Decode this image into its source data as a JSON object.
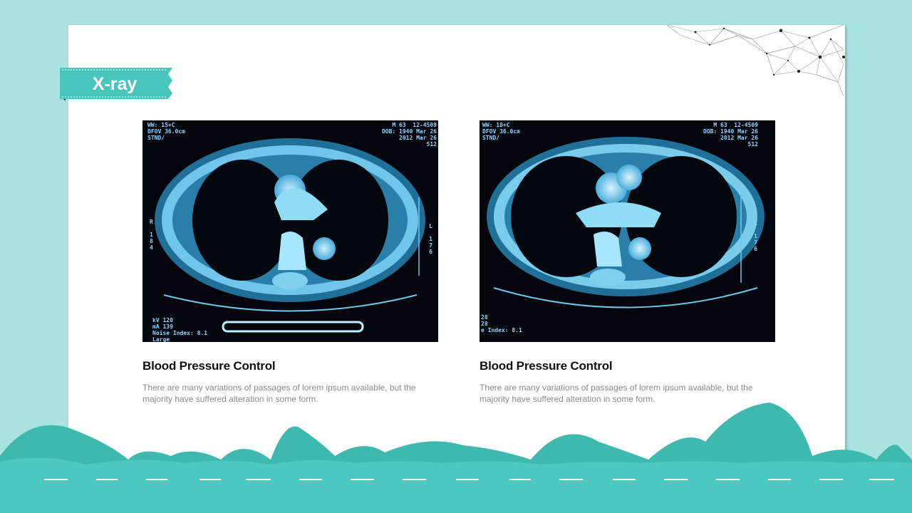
{
  "slide": {
    "section_label": "X-ray"
  },
  "cards": [
    {
      "image_alt": "CT chest scan",
      "scan_text": {
        "top_left": "WW: 15+C\nDFOV 36.0cm\nSTND/",
        "top_right": "M 63  12-4509\nDOB: 1940 Mar 26\n2012 Mar 26\n512",
        "left_side": "R\n\n1\n8\n4",
        "right_side": "L\n\n1\n7\n6",
        "bottom_left": "kV 120\nmA 139\nNoise Index: 8.1\nLarge"
      },
      "title": "Blood Pressure Control",
      "description": "There are many variations of passages of lorem ipsum available, but the majority have suffered alteration in some form."
    },
    {
      "image_alt": "CT chest scan",
      "scan_text": {
        "top_left": "WW: 18+C\nDFOV 36.0cm\nSTND/",
        "top_right": "M 63  12-4509\nDOB: 1940 Mar 26\n2012 Mar 26\n512",
        "left_side": "",
        "right_side": "L\n\n1\n7\n6",
        "bottom_left": "28\n28\ne Index: 8.1"
      },
      "title": "Blood Pressure Control",
      "description": "There are many variations of passages of lorem ipsum available, but the majority have suffered alteration in some form."
    }
  ],
  "colors": {
    "background": "#a8e3df",
    "accent": "#45c3b8",
    "hill_dark": "#3fb8ad",
    "ground": "#4ccac0",
    "scan_glow": "#7fd6f5"
  }
}
